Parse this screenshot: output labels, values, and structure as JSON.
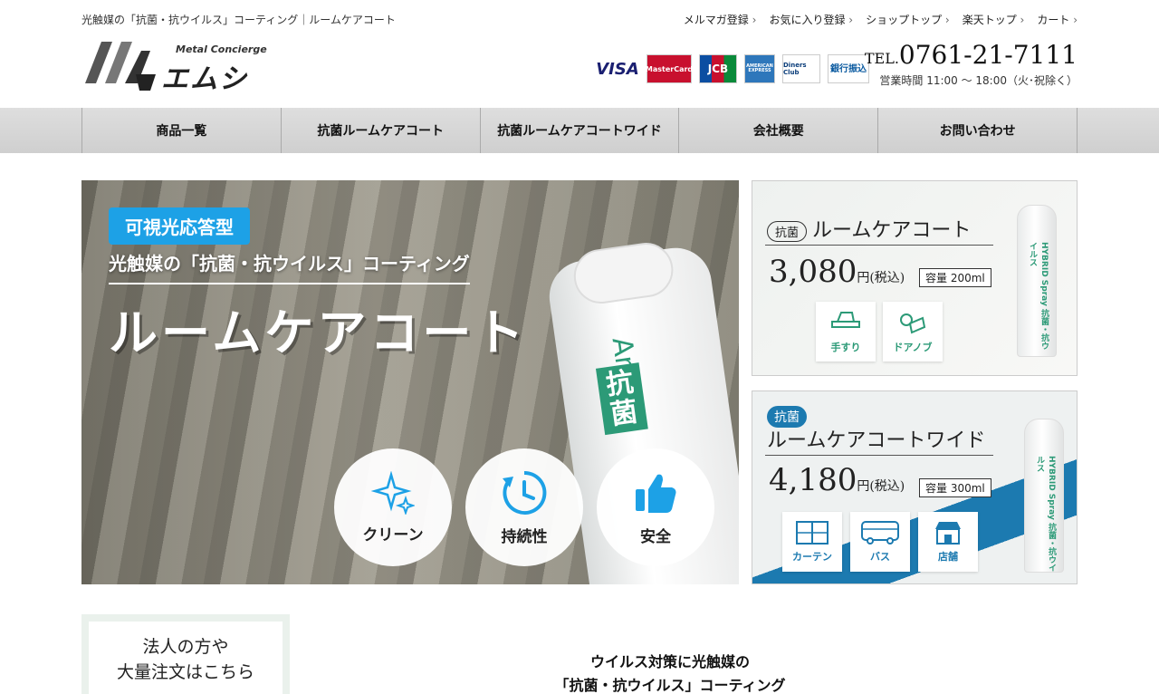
{
  "header": {
    "tagline": "光触媒の「抗菌・抗ウイルス」コーティング｜ルームケアコート",
    "top_links": [
      "メルマガ登録",
      "お気に入り登録",
      "ショップトップ",
      "楽天トップ",
      "カート"
    ],
    "logo_sub": "Metal Concierge",
    "logo_main": "エムシー",
    "payments": [
      "VISA",
      "MasterCard",
      "JCB",
      "AMERICAN EXPRESS",
      "Diners Club",
      "銀行振込"
    ],
    "tel_prefix": "TEL.",
    "tel_number": "0761-21-7111",
    "hours": "営業時間 11:00 ～ 18:00（火･祝除く）"
  },
  "nav": [
    "商品一覧",
    "抗菌ルームケアコート",
    "抗菌ルームケアコートワイド",
    "会社概要",
    "お問い合わせ"
  ],
  "hero": {
    "badge": "可視光応答型",
    "subtitle": "光触媒の「抗菌・抗ウイルス」コーティング",
    "title": "ルームケアコート",
    "can_label": "抗菌",
    "can_brand": "Antiv",
    "features": [
      "クリーン",
      "持続性",
      "安全"
    ]
  },
  "products": [
    {
      "tag": "抗菌",
      "name": "ルームケアコート",
      "price": "3,080",
      "price_unit": "円(税込)",
      "volume": "容量 200ml",
      "uses": [
        "手すり",
        "ドアノブ"
      ],
      "bottle_label": "HYBRID Spray 抗菌・抗ウイルス"
    },
    {
      "tag": "抗菌",
      "name": "ルームケアコートワイド",
      "price": "4,180",
      "price_unit": "円(税込)",
      "volume": "容量 300ml",
      "uses": [
        "カーテン",
        "バス",
        "店舗"
      ],
      "bottle_label": "HYBRID Spray 抗菌・抗ウイルス"
    }
  ],
  "corporate": {
    "line1": "法人の方や",
    "line2": "大量注文はこちら"
  },
  "intro": {
    "line1": "ウイルス対策に光触媒の",
    "line2": "「抗菌・抗ウイルス」コーティング"
  }
}
